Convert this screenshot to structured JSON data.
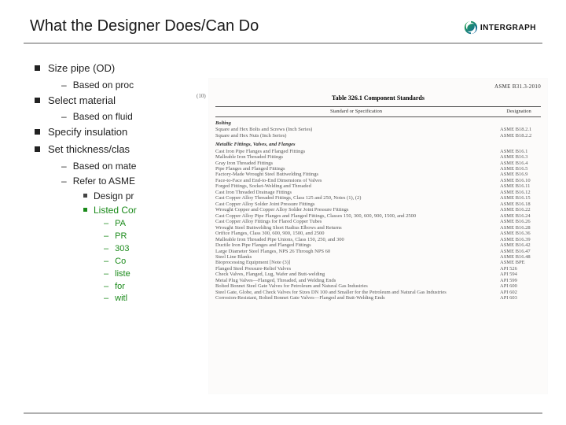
{
  "title": "What the Designer Does/Can Do",
  "logo_text": "INTERGRAPH",
  "bullets": {
    "b1": "Size pipe (OD)",
    "b1a": "Based on proc",
    "b2": "Select material",
    "b2a": "Based on fluid",
    "b3": "Specify insulation",
    "b4": "Set thickness/clas",
    "b4a": "Based on mate",
    "b4b": "Refer to ASME",
    "b4b1": "Design pr",
    "b4b2": "Listed Cor",
    "b4b2a": "PA",
    "b4b2b": "PR",
    "b4b2c": "303",
    "b4b2d": "Co",
    "b4b2e": "liste",
    "b4b2f": "for",
    "b4b2g": "witl"
  },
  "spec": {
    "topline": "ASME B31.3-2010",
    "caption": "Table 326.1   Component Standards",
    "col1": "Standard or Specification",
    "col2": "Designation",
    "note": "(10)",
    "groups": [
      {
        "name": "Bolting",
        "rows": [
          [
            "Square and Hex Bolts and Screws (Inch Series)",
            "ASME B18.2.1"
          ],
          [
            "Square and Hex Nuts (Inch Series)",
            "ASME B18.2.2"
          ]
        ]
      },
      {
        "name": "Metallic Fittings, Valves, and Flanges",
        "rows": [
          [
            "Cast Iron Pipe Flanges and Flanged Fittings",
            "ASME B16.1"
          ],
          [
            "Malleable Iron Threaded Fittings",
            "ASME B16.3"
          ],
          [
            "Gray Iron Threaded Fittings",
            "ASME B16.4"
          ],
          [
            "Pipe Flanges and Flanged Fittings",
            "ASME B16.5"
          ],
          [
            "Factory-Made Wrought Steel Buttwelding Fittings",
            "ASME B16.9"
          ],
          [
            "Face-to-Face and End-to-End Dimensions of Valves",
            "ASME B16.10"
          ],
          [
            "Forged Fittings, Socket-Welding and Threaded",
            "ASME B16.11"
          ],
          [
            "Cast Iron Threaded Drainage Fittings",
            "ASME B16.12"
          ],
          [
            "Cast Copper Alloy Threaded Fittings, Class 125 and 250,  Notes (1), (2)",
            "ASME B16.15"
          ],
          [
            "Cast Copper Alloy Solder Joint Pressure Fittings",
            "ASME B16.18"
          ],
          [
            "Wrought Copper and Copper Alloy Solder Joint Pressure Fittings",
            "ASME B16.22"
          ],
          [
            "Cast Copper Alloy Pipe Flanges and Flanged Fittings, Classes 150, 300, 600, 900, 1500, and 2500",
            "ASME B16.24"
          ],
          [
            "Cast Copper Alloy Fittings for Flared Copper Tubes",
            "ASME B16.26"
          ],
          [
            "Wrought Steel Buttwelding Short Radius Elbows and Returns",
            "ASME B16.28"
          ],
          [
            "Orifice Flanges, Class 300, 600, 900, 1500, and 2500",
            "ASME B16.36"
          ],
          [
            "Malleable Iron Threaded Pipe Unions, Class 150, 250, and 300",
            "ASME B16.39"
          ],
          [
            "Ductile Iron Pipe Flanges and Flanged Fittings",
            "ASME B16.42"
          ],
          [
            "Large Diameter Steel Flanges, NPS 26 Through NPS 60",
            "ASME B16.47"
          ],
          [
            "Steel Line Blanks",
            "ASME B16.48"
          ],
          [
            "Bioprocessing Equipment  [Note (3)]",
            "ASME BPE"
          ]
        ]
      },
      {
        "name": "",
        "rows": [
          [
            "Flanged Steel Pressure-Relief Valves",
            "API 526"
          ],
          [
            "Check Valves, Flanged, Lug, Wafer and Butt-welding",
            "API 594"
          ],
          [
            "Metal Plug Valves—Flanged, Threaded, and Welding Ends",
            "API 599"
          ],
          [
            "Bolted Bonnet Steel Gate Valves for Petroleum and Natural Gas Industries",
            "API 600"
          ],
          [
            "Steel Gate, Globe, and Check Valves for Sizes DN 100 and Smaller for the Petroleum and Natural Gas Industries",
            "API 602"
          ],
          [
            "Corrosion-Resistant, Bolted Bonnet Gate Valves—Flanged and Butt-Welding Ends",
            "API 603"
          ]
        ]
      }
    ]
  }
}
